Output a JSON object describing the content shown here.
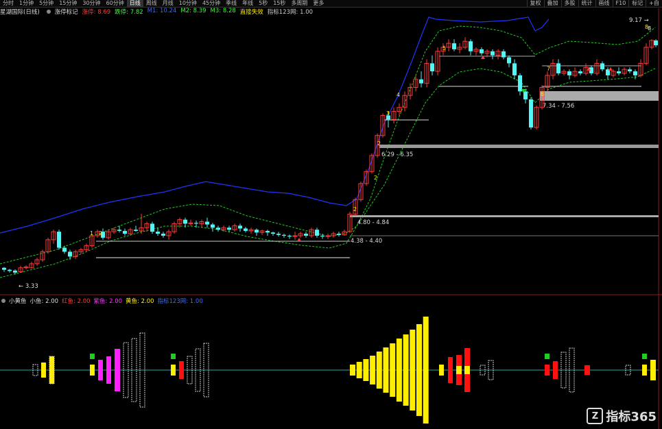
{
  "toolbar": {
    "tabs": [
      "分时",
      "1分钟",
      "5分钟",
      "15分钟",
      "30分钟",
      "60分钟",
      "日线",
      "周线",
      "月线",
      "10分钟",
      "45分钟",
      "季线",
      "年线",
      "5秒",
      "15秒",
      "多周期",
      "更多"
    ],
    "active_index": 6,
    "right_tabs": [
      "复权",
      "叠加",
      "多股",
      "统计",
      "画线",
      "F10",
      "标记",
      "+自"
    ]
  },
  "title_bar": {
    "stock_name": "星湖国际(日线)",
    "indicator_name": "涨停标记",
    "params": [
      {
        "label": "涨停: 8.69",
        "color": "#ff3b3b"
      },
      {
        "label": "跌停: 7.82",
        "color": "#33ff33"
      },
      {
        "label": "M1: 10.24",
        "color": "#3a6bff"
      },
      {
        "label": "M2: 8.39",
        "color": "#33ff33"
      },
      {
        "label": "M3: 8.28",
        "color": "#33ff33"
      },
      {
        "label": "直接失效",
        "color": "#ffee00"
      },
      {
        "label": "指标123网: 1.00",
        "color": "#cccccc"
      }
    ]
  },
  "sub_title_bar": {
    "indicator_name": "小黄鱼",
    "params": [
      {
        "label": "小鱼: 2.00",
        "color": "#dddddd"
      },
      {
        "label": "红鱼: 2.00",
        "color": "#ff3b3b"
      },
      {
        "label": "紫鱼: 2.00",
        "color": "#ff33ff"
      },
      {
        "label": "黄鱼: 2.00",
        "color": "#ffee00"
      },
      {
        "label": "指标123网: 1.00",
        "color": "#3a6bff"
      }
    ]
  },
  "price_labels": {
    "low": "3.33",
    "high": "9.17",
    "zone1": "4.38 - 4.40",
    "zone2": "4.80 - 4.84",
    "zone3": "6.29 - 6.35",
    "zone4": "7.34 - 7.56",
    "count_top": "8"
  },
  "count_markers": [
    "1",
    "2",
    "2",
    "2",
    "2",
    "3",
    "4",
    "5",
    "6",
    "7",
    "8"
  ],
  "watermark": "指标365",
  "colors": {
    "up": "#ff3b3b",
    "down": "#54f5f5",
    "upper_band": "#2233ff",
    "mid_band": "#22cc22",
    "yellow": "#ffee00",
    "magenta": "#ff22ff",
    "red": "#ff1111",
    "green": "#22cc22",
    "zero_line": "#2aa6a6"
  }
}
